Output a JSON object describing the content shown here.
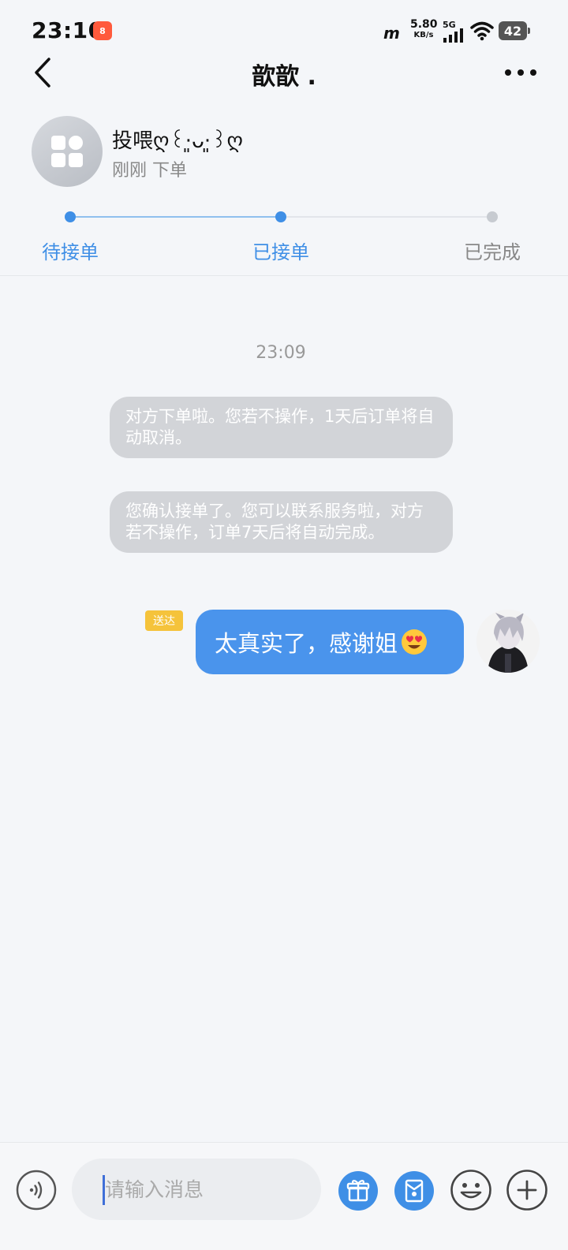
{
  "status_bar": {
    "time": "23:10",
    "app_badge": "8",
    "carrier_logo": "m",
    "net_speed_value": "5.80",
    "net_speed_unit": "KB/s",
    "net_type": "5G",
    "battery": "42"
  },
  "header": {
    "title": "歆歆 ."
  },
  "order": {
    "name": "投喂ღ꒰⋅͈ᴗ⋅͈꒱ღ",
    "status": "刚刚 下单",
    "steps": [
      "待接单",
      "已接单",
      "已完成"
    ],
    "current_step": 2
  },
  "chat": {
    "timestamp": "23:09",
    "system_messages": [
      "对方下单啦。您若不操作，1天后订单将自动取消。",
      "您确认接单了。您可以联系服务啦，对方若不操作，订单7天后将自动完成。"
    ],
    "my_message": {
      "status": "送达",
      "text": "太真实了，感谢姐",
      "emoji": "heart-eyes-emoji"
    }
  },
  "input_bar": {
    "placeholder": "请输入消息"
  },
  "icons": {
    "back": "chevron-left-icon",
    "more": "more-dots-icon",
    "voice": "voice-icon",
    "gift": "gift-icon",
    "envelope": "envelope-icon",
    "emoji": "emoji-icon",
    "plus": "plus-icon"
  },
  "colors": {
    "accent": "#3f8fe6",
    "bubble_mine": "#4a94ec",
    "bubble_system": "#d2d4d8",
    "sent_badge": "#f5c33b",
    "background": "#f4f6f9"
  }
}
